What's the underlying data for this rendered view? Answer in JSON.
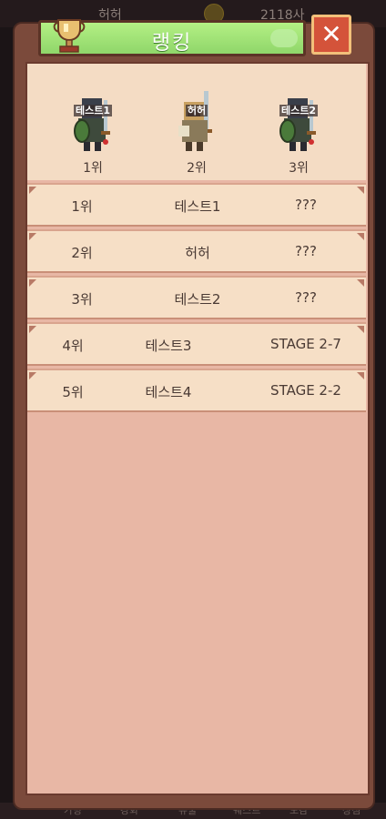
{
  "background_hud": {
    "player_name": "허허",
    "info_text": "2118사",
    "tabs": [
      "가방",
      "강화",
      "유물",
      "퀘스트",
      "도감",
      "상점"
    ]
  },
  "dialog": {
    "title": "랭킹",
    "close_symbol": "✕",
    "colors": {
      "title_bar": "#9fe076",
      "close_button": "#d4533a",
      "panel_frame": "#7b4a3b",
      "panel_fill": "#e8b7a5",
      "row_fill": "#f6dfc6"
    }
  },
  "podium": [
    {
      "name": "테스트1",
      "rank": "1위",
      "icon": "knight-with-shield-icon"
    },
    {
      "name": "허허",
      "rank": "2위",
      "icon": "warrior-with-sword-icon"
    },
    {
      "name": "테스트2",
      "rank": "3위",
      "icon": "knight-with-shield-icon"
    }
  ],
  "ranking_rows": [
    {
      "rank": "1위",
      "name": "테스트1",
      "stage": "???"
    },
    {
      "rank": "2위",
      "name": "허허",
      "stage": "???"
    },
    {
      "rank": "3위",
      "name": "테스트2",
      "stage": "???"
    },
    {
      "rank": "4위",
      "name": "테스트3",
      "stage": "STAGE 2-7"
    },
    {
      "rank": "5위",
      "name": "테스트4",
      "stage": "STAGE 2-2"
    }
  ]
}
